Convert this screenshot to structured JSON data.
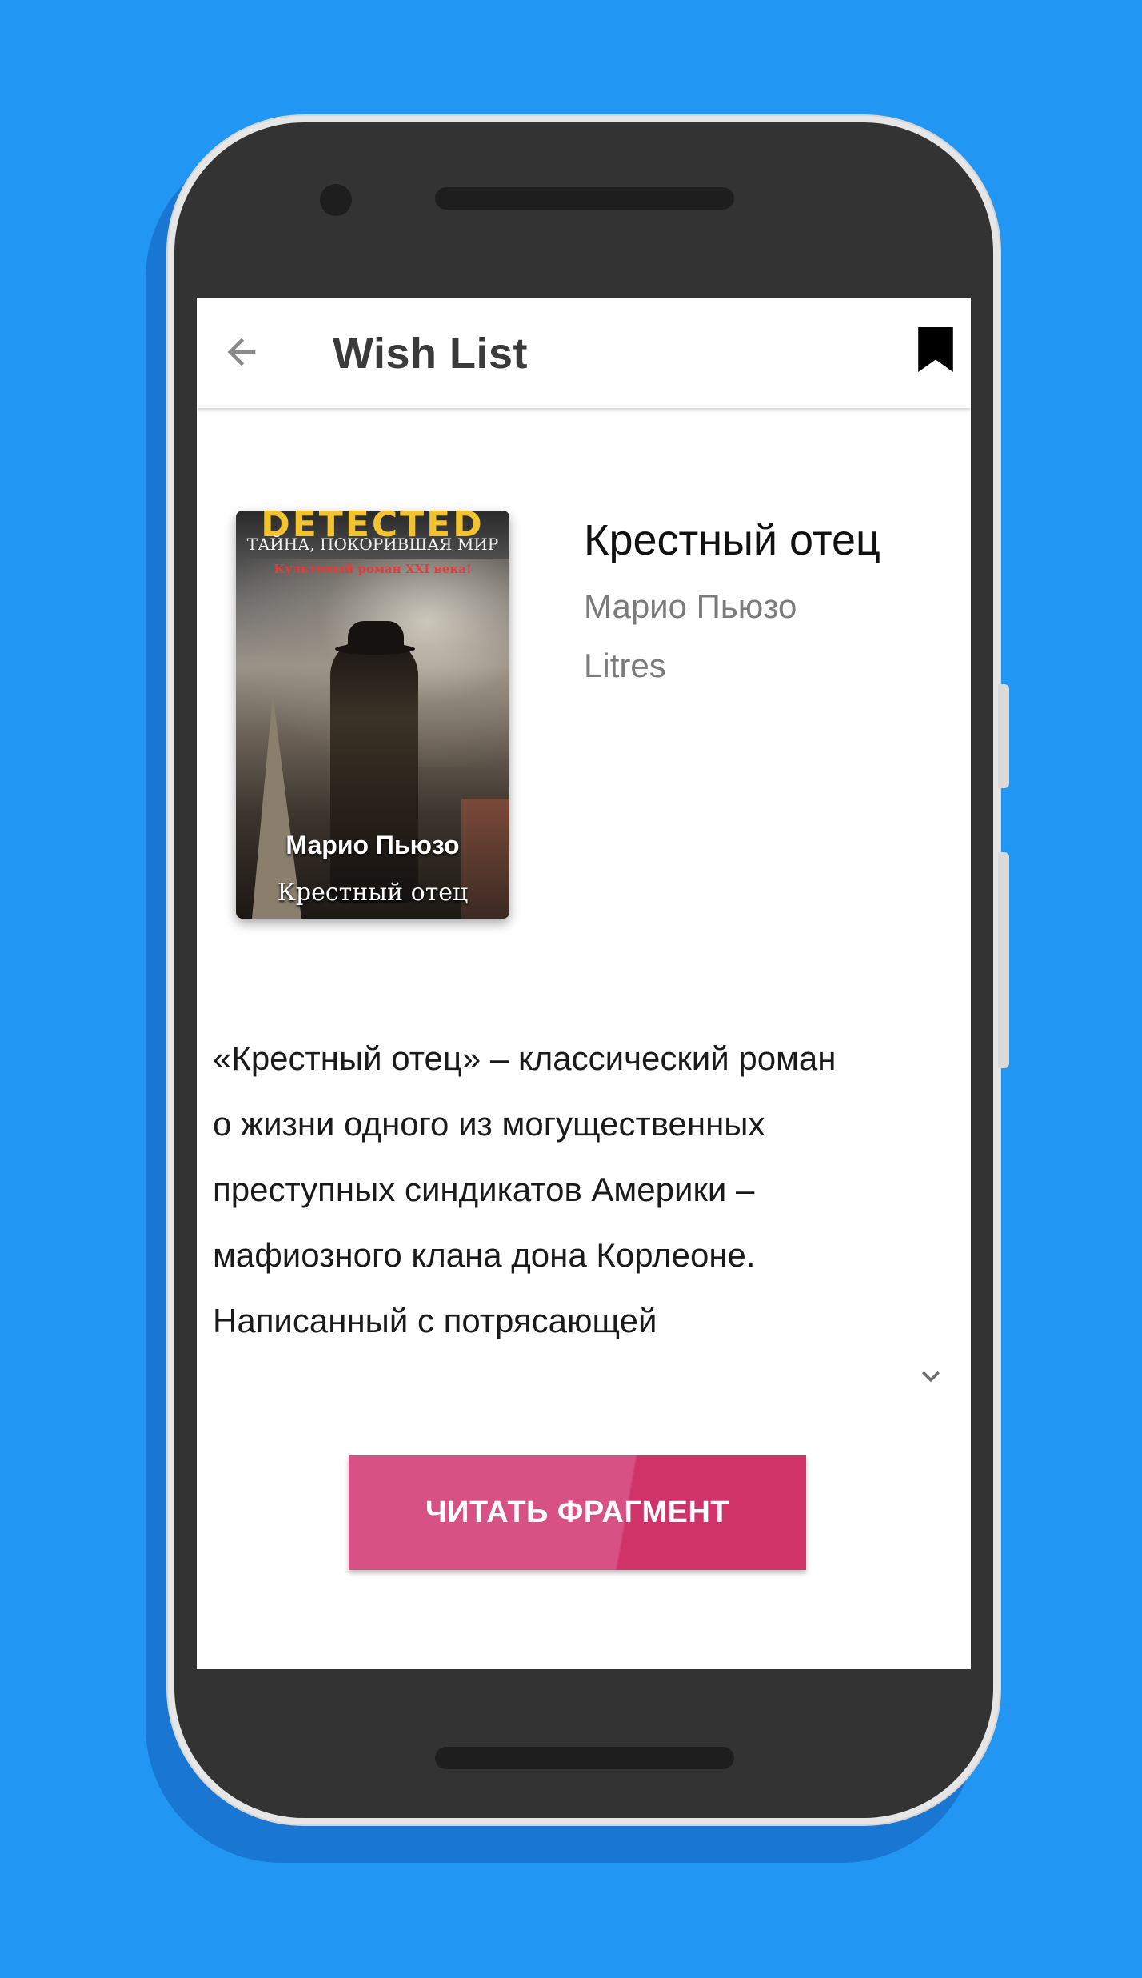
{
  "appbar": {
    "title": "Wish List",
    "back_icon": "arrow-left-icon",
    "bookmark_icon": "bookmark-icon"
  },
  "book": {
    "title": "Крестный отец",
    "author": "Марио Пьюзо",
    "source": "Litres",
    "cover": {
      "series": "DETECTED",
      "tagline": "ТАЙНА, ПОКОРИВШАЯ МИР",
      "subtitle": "Культовый роман XXI века!",
      "author": "Марио Пьюзо",
      "title": "Крестный отец"
    },
    "description_lines": [
      "«Крестный отец» – классический роман",
      "о жизни одного из могущественных",
      "преступных синдикатов Америки –",
      "мафиозного клана дона Корлеоне.",
      "Написанный с потрясающей"
    ],
    "expand_icon": "chevron-down-icon"
  },
  "actions": {
    "read_fragment_label": "ЧИТАТЬ ФРАГМЕНТ"
  },
  "colors": {
    "background": "#2196F3",
    "button_primary": "#D75184",
    "button_accent": "#CF3368"
  }
}
